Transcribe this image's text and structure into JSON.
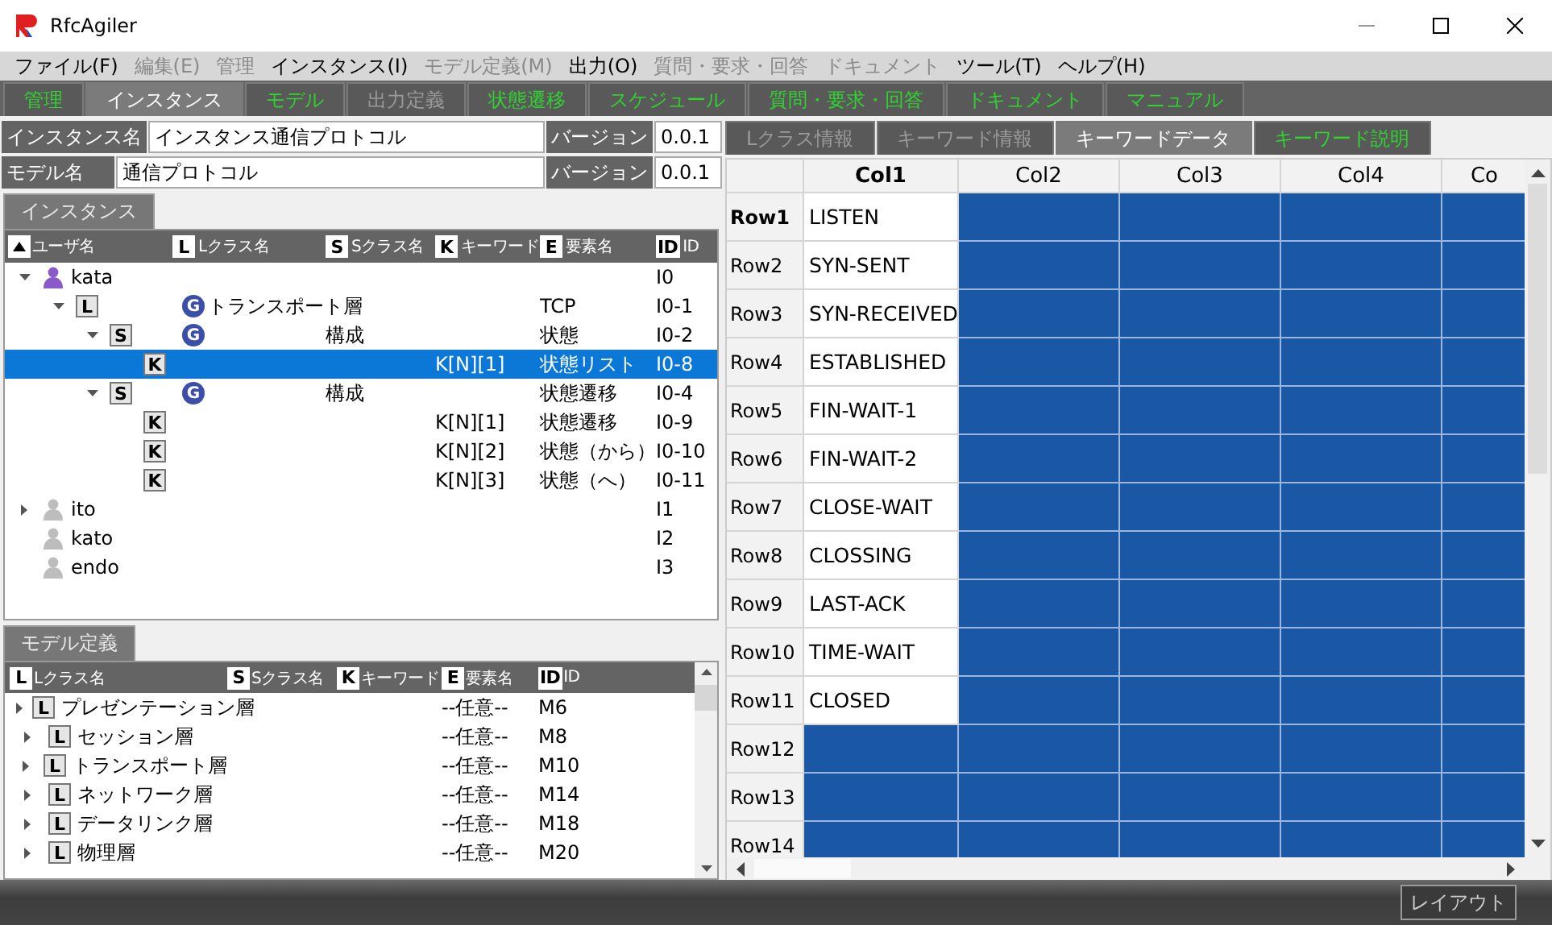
{
  "window": {
    "title": "RfcAgiler"
  },
  "menu": [
    {
      "label": "ファイル(F)",
      "disabled": false
    },
    {
      "label": "編集(E)",
      "disabled": true
    },
    {
      "label": "管理",
      "disabled": true
    },
    {
      "label": "インスタンス(I)",
      "disabled": false
    },
    {
      "label": "モデル定義(M)",
      "disabled": true
    },
    {
      "label": "出力(O)",
      "disabled": false
    },
    {
      "label": "質問・要求・回答",
      "disabled": true
    },
    {
      "label": "ドキュメント",
      "disabled": true
    },
    {
      "label": "ツール(T)",
      "disabled": false
    },
    {
      "label": "ヘルプ(H)",
      "disabled": false
    }
  ],
  "main_tabs": [
    {
      "label": "管理",
      "selected": false,
      "disabled": false
    },
    {
      "label": "インスタンス",
      "selected": true,
      "disabled": false
    },
    {
      "label": "モデル",
      "selected": false,
      "disabled": false
    },
    {
      "label": "出力定義",
      "selected": false,
      "disabled": true
    },
    {
      "label": "状態遷移",
      "selected": false,
      "disabled": false
    },
    {
      "label": "スケジュール",
      "selected": false,
      "disabled": false
    },
    {
      "label": "質問・要求・回答",
      "selected": false,
      "disabled": false
    },
    {
      "label": "ドキュメント",
      "selected": false,
      "disabled": false
    },
    {
      "label": "マニュアル",
      "selected": false,
      "disabled": false
    }
  ],
  "fields": [
    {
      "label": "インスタンス名",
      "value": "インスタンス通信プロトコル",
      "version_label": "バージョン",
      "version": "0.0.1"
    },
    {
      "label": "モデル名",
      "value": "通信プロトコル",
      "version_label": "バージョン",
      "version": "0.0.1"
    }
  ],
  "instance_tree": {
    "tab": "インスタンス",
    "columns": [
      {
        "kind": "sort",
        "label": "ユーザ名"
      },
      {
        "kind": "badge",
        "badge": "L",
        "label": "Lクラス名"
      },
      {
        "kind": "badge",
        "badge": "S",
        "label": "Sクラス名"
      },
      {
        "kind": "badge",
        "badge": "K",
        "label": "キーワード"
      },
      {
        "kind": "badge",
        "badge": "E",
        "label": "要素名"
      },
      {
        "kind": "badge",
        "badge": "ID",
        "label": "ID"
      }
    ],
    "rows": [
      {
        "kind": "user",
        "name": "kata",
        "active": true,
        "id": "I0",
        "expanded": true,
        "selected": false,
        "children": [
          {
            "kind": "item",
            "badge": "L",
            "group": "G",
            "lclass": "トランスポート層",
            "element": "TCP",
            "id": "I0-1",
            "expanded": true,
            "selected": false,
            "children": [
              {
                "kind": "item",
                "badge": "S",
                "group": "G",
                "sclass": "構成",
                "element": "状態",
                "id": "I0-2",
                "expanded": true,
                "selected": false,
                "children": [
                  {
                    "kind": "item",
                    "badge": "K",
                    "keyword": "K[N][1]",
                    "element": "状態リスト",
                    "id": "I0-8",
                    "selected": true
                  }
                ]
              },
              {
                "kind": "item",
                "badge": "S",
                "group": "G",
                "sclass": "構成",
                "element": "状態遷移",
                "id": "I0-4",
                "expanded": true,
                "selected": false,
                "children": [
                  {
                    "kind": "item",
                    "badge": "K",
                    "keyword": "K[N][1]",
                    "element": "状態遷移",
                    "id": "I0-9",
                    "selected": false
                  },
                  {
                    "kind": "item",
                    "badge": "K",
                    "keyword": "K[N][2]",
                    "element": "状態（から）",
                    "id": "I0-10",
                    "selected": false
                  },
                  {
                    "kind": "item",
                    "badge": "K",
                    "keyword": "K[N][3]",
                    "element": "状態（へ）",
                    "id": "I0-11",
                    "selected": false
                  }
                ]
              }
            ]
          }
        ]
      },
      {
        "kind": "user",
        "name": "ito",
        "active": false,
        "id": "I1",
        "expanded": false,
        "selected": false
      },
      {
        "kind": "user",
        "name": "kato",
        "active": false,
        "id": "I2",
        "selected": false
      },
      {
        "kind": "user",
        "name": "endo",
        "active": false,
        "id": "I3",
        "selected": false
      }
    ]
  },
  "model_list": {
    "tab": "モデル定義",
    "columns": [
      {
        "badge": "L",
        "label": "Lクラス名"
      },
      {
        "badge": "S",
        "label": "Sクラス名"
      },
      {
        "badge": "K",
        "label": "キーワード"
      },
      {
        "badge": "E",
        "label": "要素名"
      },
      {
        "badge": "ID",
        "label": "ID"
      }
    ],
    "rows": [
      {
        "badge": "L",
        "lclass": "プレゼンテーション層",
        "element": "--任意--",
        "id": "M6",
        "expanded": false
      },
      {
        "badge": "L",
        "lclass": "セッション層",
        "element": "--任意--",
        "id": "M8",
        "expanded": false
      },
      {
        "badge": "L",
        "lclass": "トランスポート層",
        "element": "--任意--",
        "id": "M10",
        "expanded": false
      },
      {
        "badge": "L",
        "lclass": "ネットワーク層",
        "element": "--任意--",
        "id": "M14",
        "expanded": false
      },
      {
        "badge": "L",
        "lclass": "データリンク層",
        "element": "--任意--",
        "id": "M18",
        "expanded": false
      },
      {
        "badge": "L",
        "lclass": "物理層",
        "element": "--任意--",
        "id": "M20",
        "expanded": false
      }
    ]
  },
  "detail_tabs": [
    {
      "label": "Lクラス情報",
      "selected": false,
      "disabled": true
    },
    {
      "label": "キーワード情報",
      "selected": false,
      "disabled": true
    },
    {
      "label": "キーワードデータ",
      "selected": true,
      "disabled": false
    },
    {
      "label": "キーワード説明",
      "selected": false,
      "disabled": false
    }
  ],
  "grid": {
    "columns": [
      {
        "label": "Col1",
        "current": true
      },
      {
        "label": "Col2",
        "current": false
      },
      {
        "label": "Col3",
        "current": false
      },
      {
        "label": "Col4",
        "current": false
      },
      {
        "label": "Co",
        "current": false
      }
    ],
    "rows": [
      {
        "header": "Row1",
        "current": true,
        "cells": [
          {
            "text": "LISTEN",
            "selected": false
          },
          {
            "selected": true
          },
          {
            "selected": true
          },
          {
            "selected": true
          },
          {
            "selected": true
          }
        ]
      },
      {
        "header": "Row2",
        "current": false,
        "cells": [
          {
            "text": "SYN-SENT",
            "selected": false
          },
          {
            "selected": true
          },
          {
            "selected": true
          },
          {
            "selected": true
          },
          {
            "selected": true
          }
        ]
      },
      {
        "header": "Row3",
        "current": false,
        "cells": [
          {
            "text": "SYN-RECEIVED",
            "selected": false
          },
          {
            "selected": true
          },
          {
            "selected": true
          },
          {
            "selected": true
          },
          {
            "selected": true
          }
        ]
      },
      {
        "header": "Row4",
        "current": false,
        "cells": [
          {
            "text": "ESTABLISHED",
            "selected": false
          },
          {
            "selected": true
          },
          {
            "selected": true
          },
          {
            "selected": true
          },
          {
            "selected": true
          }
        ]
      },
      {
        "header": "Row5",
        "current": false,
        "cells": [
          {
            "text": "FIN-WAIT-1",
            "selected": false
          },
          {
            "selected": true
          },
          {
            "selected": true
          },
          {
            "selected": true
          },
          {
            "selected": true
          }
        ]
      },
      {
        "header": "Row6",
        "current": false,
        "cells": [
          {
            "text": "FIN-WAIT-2",
            "selected": false
          },
          {
            "selected": true
          },
          {
            "selected": true
          },
          {
            "selected": true
          },
          {
            "selected": true
          }
        ]
      },
      {
        "header": "Row7",
        "current": false,
        "cells": [
          {
            "text": "CLOSE-WAIT",
            "selected": false
          },
          {
            "selected": true
          },
          {
            "selected": true
          },
          {
            "selected": true
          },
          {
            "selected": true
          }
        ]
      },
      {
        "header": "Row8",
        "current": false,
        "cells": [
          {
            "text": "CLOSSING",
            "selected": false
          },
          {
            "selected": true
          },
          {
            "selected": true
          },
          {
            "selected": true
          },
          {
            "selected": true
          }
        ]
      },
      {
        "header": "Row9",
        "current": false,
        "cells": [
          {
            "text": "LAST-ACK",
            "selected": false
          },
          {
            "selected": true
          },
          {
            "selected": true
          },
          {
            "selected": true
          },
          {
            "selected": true
          }
        ]
      },
      {
        "header": "Row10",
        "current": false,
        "cells": [
          {
            "text": "TIME-WAIT",
            "selected": false
          },
          {
            "selected": true
          },
          {
            "selected": true
          },
          {
            "selected": true
          },
          {
            "selected": true
          }
        ]
      },
      {
        "header": "Row11",
        "current": false,
        "cells": [
          {
            "text": "CLOSED",
            "selected": false
          },
          {
            "selected": true
          },
          {
            "selected": true
          },
          {
            "selected": true
          },
          {
            "selected": true
          }
        ]
      },
      {
        "header": "Row12",
        "current": false,
        "cells": [
          {
            "selected": true
          },
          {
            "selected": true
          },
          {
            "selected": true
          },
          {
            "selected": true
          },
          {
            "selected": true
          }
        ]
      },
      {
        "header": "Row13",
        "current": false,
        "cells": [
          {
            "selected": true
          },
          {
            "selected": true
          },
          {
            "selected": true
          },
          {
            "selected": true
          },
          {
            "selected": true
          }
        ]
      },
      {
        "header": "Row14",
        "current": false,
        "cells": [
          {
            "selected": true
          },
          {
            "selected": true
          },
          {
            "selected": true
          },
          {
            "selected": true
          },
          {
            "selected": true
          }
        ]
      }
    ]
  },
  "status_bar": {
    "button": "レイアウト"
  }
}
